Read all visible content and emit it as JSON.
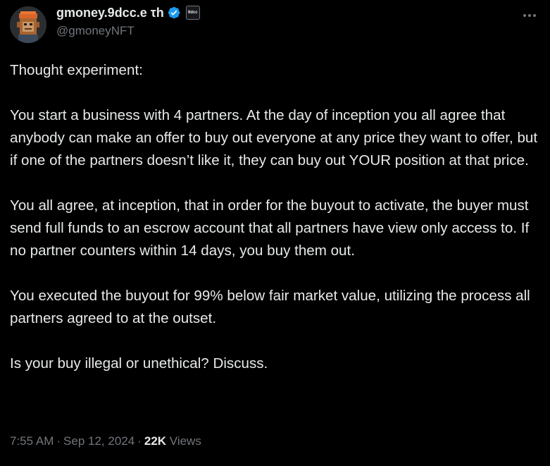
{
  "author": {
    "display_name": "gmoney.9dcc.e τh",
    "handle": "@gmoneyNFT",
    "avatar_icon": "pixel-ape-avatar",
    "verified_icon": "verified-badge-icon",
    "affiliate_badge_text": "9dcc",
    "accent_color": "#1d9bf0"
  },
  "more_icon": "more-horizontal-icon",
  "tweet": {
    "paragraphs": [
      "Thought experiment:",
      "You start a business with 4 partners.  At the day of inception you all agree that anybody can make an offer to buy out everyone at any price they want to offer, but if one of the partners doesn’t like it, they can buy out YOUR position at that price.",
      "You all agree, at inception, that in order for the buyout to activate, the buyer must send full funds to an escrow account that all partners have view only access to.   If no partner counters within 14 days, you buy them out.",
      "You executed the buyout for 99% below fair market value, utilizing the process all partners agreed to at the outset.",
      "Is your buy illegal or unethical?  Discuss."
    ]
  },
  "meta": {
    "time": "7:55 AM",
    "date": "Sep 12, 2024",
    "separator": "·",
    "views_count": "22K",
    "views_label": "Views"
  },
  "colors": {
    "background": "#000000",
    "text_primary": "#e7e9ea",
    "text_secondary": "#71767b"
  }
}
